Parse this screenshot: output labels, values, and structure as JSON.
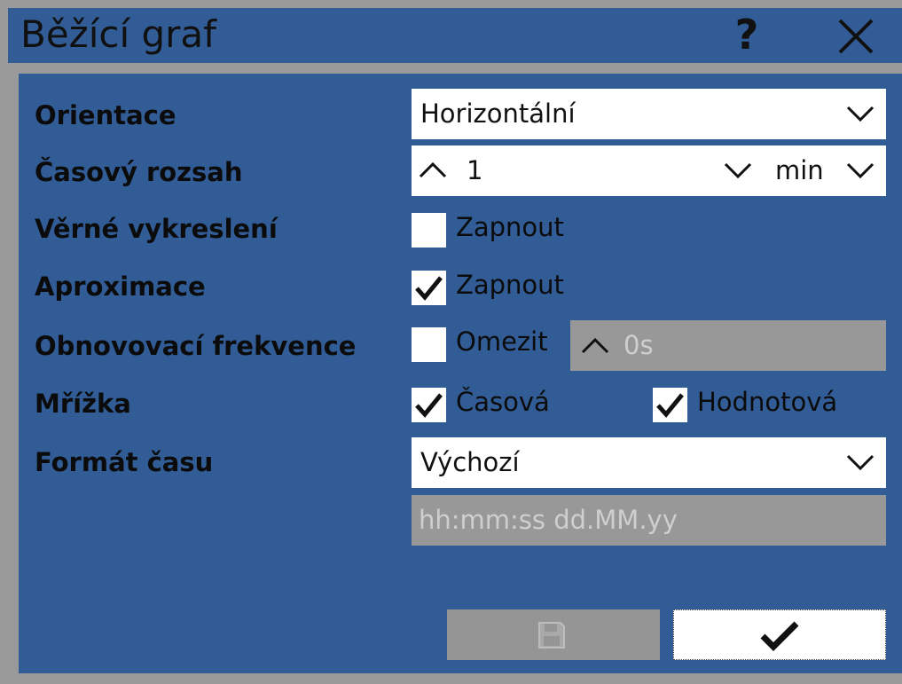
{
  "window": {
    "title": "Běžící graf",
    "help_icon": "help-icon",
    "close_icon": "close-icon"
  },
  "form": {
    "orientation": {
      "label": "Orientace",
      "value": "Horizontální"
    },
    "time_range": {
      "label": "Časový rozsah",
      "value": "1",
      "unit": "min"
    },
    "faithful_render": {
      "label": "Věrné vykreslení",
      "checkbox_label": "Zapnout",
      "checked": false
    },
    "approximation": {
      "label": "Aproximace",
      "checkbox_label": "Zapnout",
      "checked": true
    },
    "refresh_rate": {
      "label": "Obnovovací frekvence",
      "checkbox_label": "Omezit",
      "checked": false,
      "value": "0s"
    },
    "grid": {
      "label": "Mřížka",
      "time_label": "Časová",
      "time_checked": true,
      "value_label": "Hodnotová",
      "value_checked": true
    },
    "time_format": {
      "label": "Formát času",
      "value": "Výchozí",
      "pattern": "hh:mm:ss dd.MM.yy"
    }
  },
  "buttons": {
    "save_icon": "save-icon",
    "ok_icon": "checkmark-icon"
  },
  "colors": {
    "background": "#315c96",
    "border": "#9a9a9a",
    "disabled": "#989898"
  }
}
